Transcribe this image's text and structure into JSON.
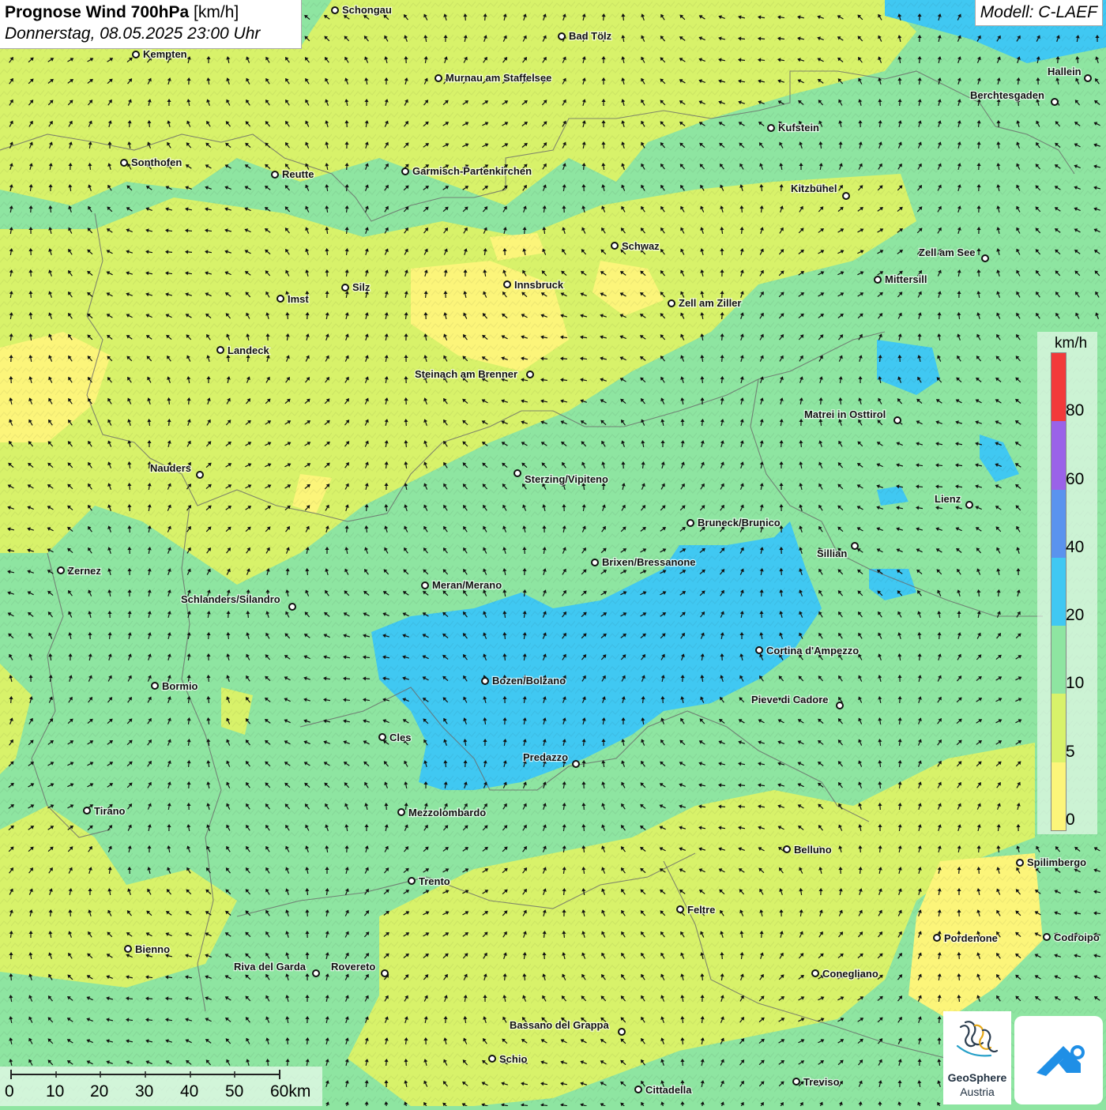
{
  "header": {
    "title_bold": "Prognose Wind 700hPa",
    "title_unit": "[km/h]",
    "datetime": "Donnerstag, 08.05.2025 23:00 Uhr"
  },
  "model": {
    "label": "Modell: C-LAEF"
  },
  "legend": {
    "unit": "km/h",
    "bins": [
      {
        "from": 0,
        "to": 5,
        "color": "#fcf57a"
      },
      {
        "from": 5,
        "to": 10,
        "color": "#d8f26a"
      },
      {
        "from": 10,
        "to": 20,
        "color": "#8ee5a1"
      },
      {
        "from": 20,
        "to": 40,
        "color": "#40c8f2"
      },
      {
        "from": 40,
        "to": 60,
        "color": "#5a93ee"
      },
      {
        "from": 60,
        "to": 80,
        "color": "#9a62e8"
      },
      {
        "from": 80,
        "to": 100,
        "color": "#f23a3a"
      }
    ],
    "ticks": [
      "0",
      "5",
      "10",
      "20",
      "40",
      "60",
      "80"
    ]
  },
  "scalebar": {
    "labels": [
      "0",
      "10",
      "20",
      "30",
      "40",
      "50",
      "60km"
    ]
  },
  "logos": {
    "geosphere_name": "GeoSphere",
    "geosphere_sub": "Austria",
    "geosphere_icon": "geosphere-logo-icon",
    "app_icon": "weather-app-icon"
  },
  "colors": {
    "map_background": "#8ee5a1",
    "calm_zone": "#d8f26a",
    "strong_zone": "#40c8f2",
    "weakest_zone": "#fcf57a"
  },
  "cities": [
    {
      "name": "Schongau"
    },
    {
      "name": "Bad Tölz"
    },
    {
      "name": "Kempten"
    },
    {
      "name": "Murnau am Staffelsee"
    },
    {
      "name": "Hallein"
    },
    {
      "name": "Berchtesgaden"
    },
    {
      "name": "Kufstein"
    },
    {
      "name": "Sonthofen"
    },
    {
      "name": "Reutte"
    },
    {
      "name": "Garmisch-Partenkirchen"
    },
    {
      "name": "Kitzbühel"
    },
    {
      "name": "Schwaz"
    },
    {
      "name": "Zell am See"
    },
    {
      "name": "Mittersill"
    },
    {
      "name": "Silz"
    },
    {
      "name": "Innsbruck"
    },
    {
      "name": "Imst"
    },
    {
      "name": "Zell am Ziller"
    },
    {
      "name": "Landeck"
    },
    {
      "name": "Steinach am Brenner"
    },
    {
      "name": "Matrei in Osttirol"
    },
    {
      "name": "Nauders"
    },
    {
      "name": "Sterzing/Vipiteno"
    },
    {
      "name": "Lienz"
    },
    {
      "name": "Bruneck/Brunico"
    },
    {
      "name": "Sillian"
    },
    {
      "name": "Zernez"
    },
    {
      "name": "Brixen/Bressanone"
    },
    {
      "name": "Meran/Merano"
    },
    {
      "name": "Schlanders/Silandro"
    },
    {
      "name": "Cortina d'Ampezzo"
    },
    {
      "name": "Bozen/Bolzano"
    },
    {
      "name": "Bormio"
    },
    {
      "name": "Pieve di Cadore"
    },
    {
      "name": "Cles"
    },
    {
      "name": "Predazzo"
    },
    {
      "name": "Tirano"
    },
    {
      "name": "Mezzolombardo"
    },
    {
      "name": "Belluno"
    },
    {
      "name": "Spilimbergo"
    },
    {
      "name": "Trento"
    },
    {
      "name": "Feltre"
    },
    {
      "name": "Pordenone"
    },
    {
      "name": "Codroipo"
    },
    {
      "name": "Bienno"
    },
    {
      "name": "Riva del Garda"
    },
    {
      "name": "Rovereto"
    },
    {
      "name": "Conegliano"
    },
    {
      "name": "Bassano del Grappa"
    },
    {
      "name": "Schio"
    },
    {
      "name": "Treviso"
    },
    {
      "name": "Cittadella"
    }
  ]
}
